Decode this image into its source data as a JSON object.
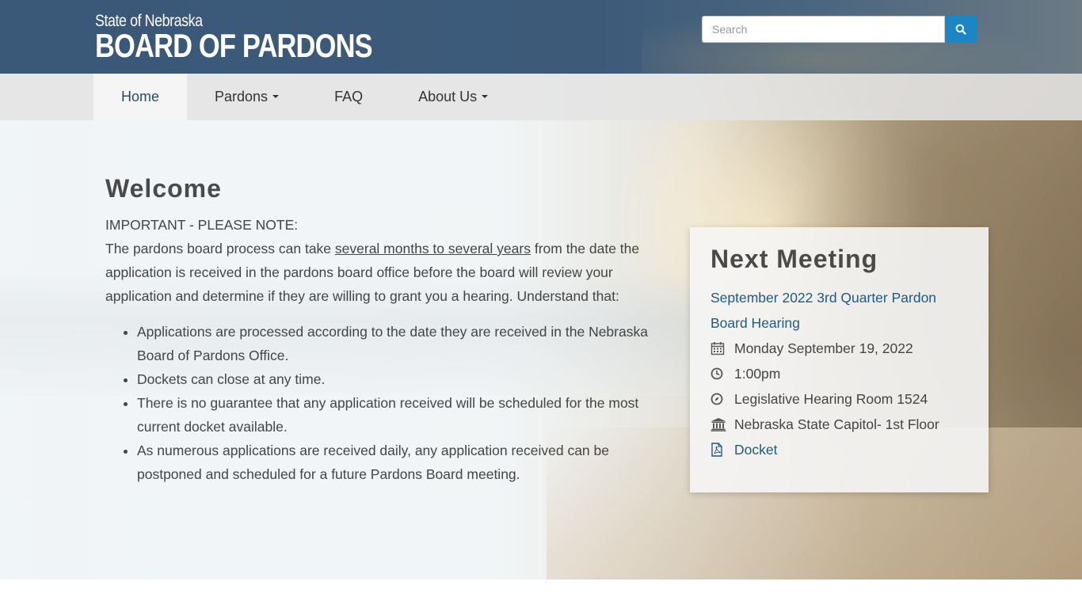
{
  "header": {
    "logo_small": "State of Nebraska",
    "logo_big": "BOARD OF PARDONS",
    "search_placeholder": "Search",
    "search_button_icon": "search-icon"
  },
  "nav": {
    "items": [
      {
        "label": "Home",
        "active": true,
        "dropdown": false
      },
      {
        "label": "Pardons",
        "active": false,
        "dropdown": true
      },
      {
        "label": "FAQ",
        "active": false,
        "dropdown": false
      },
      {
        "label": "About Us",
        "active": false,
        "dropdown": true
      }
    ]
  },
  "welcome": {
    "title": "Welcome",
    "important": "IMPORTANT - PLEASE NOTE:",
    "para_before": "The pardons board process can take ",
    "para_underlined": "several months to several years",
    "para_after": " from the date the application is received in the pardons board office before the board will review your application and determine if they are willing to grant you a hearing. Understand that:",
    "bullets": [
      "Applications are processed according to the date they are received in the Nebraska Board of Pardons Office.",
      "Dockets can close at any time.",
      "There is no guarantee that any application received will be scheduled for the most current docket available.",
      "As numerous applications are received daily, any application received can be postponed and scheduled for a future Pardons Board meeting."
    ]
  },
  "meeting": {
    "title": "Next Meeting",
    "link": "September 2022 3rd Quarter Pardon Board Hearing",
    "date": "Monday September 19, 2022",
    "time": "1:00pm",
    "room": "Legislative Hearing Room 1524",
    "building": "Nebraska State Capitol- 1st Floor",
    "docket": "Docket"
  },
  "colors": {
    "header_bg": "#3d5a79",
    "search_button": "#1a86c4",
    "link": "#1f5a82"
  }
}
